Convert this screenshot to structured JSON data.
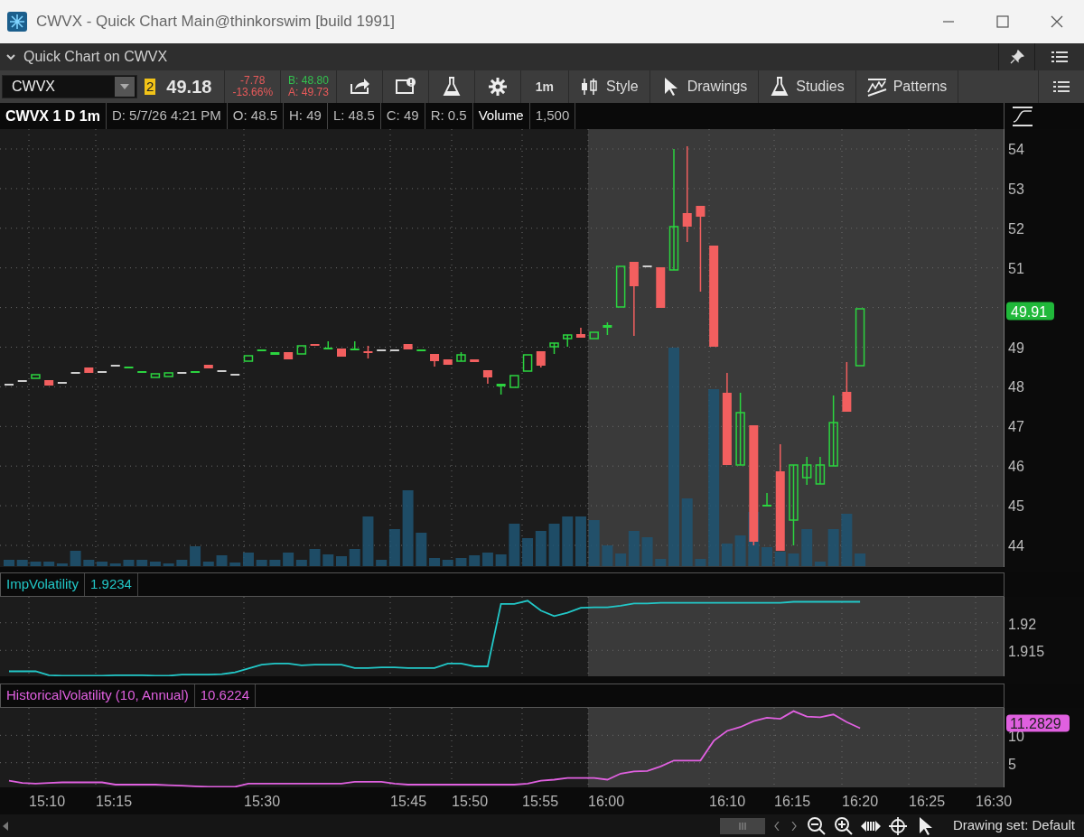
{
  "window": {
    "title": "CWVX - Quick Chart Main@thinkorswim [build 1991]"
  },
  "panel": {
    "title": "Quick Chart on CWVX"
  },
  "toolbar": {
    "symbol": "CWVX",
    "link_group": "2",
    "last": "49.18",
    "net_change": "-7.78",
    "pct_change": "-13.66%",
    "bid": "B: 48.80",
    "ask": "A: 49.73",
    "buttons": [
      "1m",
      "Style",
      "Drawings",
      "Studies",
      "Patterns"
    ]
  },
  "chart_header": {
    "title": "CWVX 1 D 1m",
    "fields": [
      "D: 5/7/26 4:21 PM",
      "O: 48.5",
      "H: 49",
      "L: 48.5",
      "C: 49",
      "R: 0.5"
    ],
    "volume": {
      "name": "Volume",
      "value": "1,500"
    }
  },
  "price_pane": {
    "axis_labels": [
      "54",
      "53",
      "52",
      "51",
      "49",
      "48",
      "47",
      "46",
      "45",
      "44"
    ],
    "last_price": "49.91"
  },
  "studies": [
    {
      "name": "ImpVolatility",
      "value": "1.9234",
      "color": "#22c8c8",
      "chart_data": {
        "type": "line",
        "ylim": [
          1.9103,
          1.9247
        ],
        "yticks": [
          1.915,
          1.92
        ],
        "series": [
          {
            "color": "#22c8c8",
            "values": [
              1.9112,
              1.9112,
              1.9112,
              1.9105,
              1.9104,
              1.9104,
              1.9104,
              1.9104,
              1.9105,
              1.9105,
              1.9105,
              1.9104,
              1.9104,
              1.9106,
              1.9106,
              1.9106,
              1.9107,
              1.911,
              1.9117,
              1.9124,
              1.9126,
              1.9126,
              1.9123,
              1.9124,
              1.9124,
              1.9124,
              1.9118,
              1.9118,
              1.9119,
              1.9119,
              1.9118,
              1.9118,
              1.9118,
              1.9126,
              1.9126,
              1.9121,
              1.9121,
              1.9234,
              1.9234,
              1.924,
              1.9222,
              1.9212,
              1.9218,
              1.9227,
              1.9228,
              1.9228,
              1.9231,
              1.9235,
              1.9235,
              1.9236,
              1.9236,
              1.9236,
              1.9236,
              1.9236,
              1.9236,
              1.9236,
              1.9236,
              1.9236,
              1.9236,
              1.9238,
              1.9238,
              1.9238,
              1.9238,
              1.9238,
              1.9238
            ]
          }
        ]
      }
    },
    {
      "name": "HistoricalVolatility (10, Annual)",
      "value": "10.6224",
      "color": "#e060e0",
      "last_label": "11.2829",
      "chart_data": {
        "type": "line",
        "ylim": [
          0.5,
          15
        ],
        "yticks": [
          5,
          10
        ],
        "series": [
          {
            "color": "#e060e0",
            "values": [
              1.7,
              1.3,
              1.2,
              1.3,
              1.4,
              1.4,
              1.4,
              1.4,
              1.0,
              1.0,
              1.0,
              1.0,
              0.9,
              0.8,
              0.7,
              0.6,
              0.6,
              0.6,
              1.2,
              1.2,
              1.2,
              1.2,
              1.2,
              1.2,
              1.2,
              1.2,
              1.5,
              1.5,
              1.5,
              1.2,
              1.0,
              1.0,
              1.0,
              1.0,
              1.0,
              1.0,
              1.0,
              1.0,
              1.0,
              1.2,
              1.7,
              1.9,
              2.2,
              2.2,
              2.2,
              1.9,
              3.0,
              3.4,
              3.5,
              4.3,
              5.4,
              5.4,
              5.4,
              9.0,
              10.8,
              11.5,
              12.6,
              13.2,
              13.0,
              14.4,
              13.4,
              13.3,
              13.8,
              12.4,
              11.3
            ]
          }
        ]
      }
    }
  ],
  "time_axis": {
    "labels": [
      "15:10",
      "15:15",
      "15:30",
      "15:45",
      "15:50",
      "15:55",
      "16:00",
      "16:10",
      "16:15",
      "16:20",
      "16:25",
      "16:30"
    ]
  },
  "status_bar": {
    "drawing_set": "Drawing set: Default"
  }
}
